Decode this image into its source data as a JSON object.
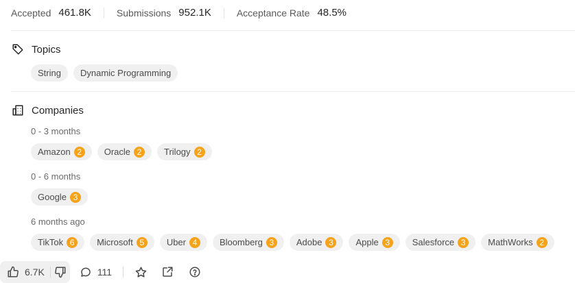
{
  "stats": [
    {
      "label": "Accepted",
      "value": "461.8K"
    },
    {
      "label": "Submissions",
      "value": "952.1K"
    },
    {
      "label": "Acceptance Rate",
      "value": "48.5%"
    }
  ],
  "topics": {
    "title": "Topics",
    "icon": "tag-icon",
    "tags": [
      "String",
      "Dynamic Programming"
    ]
  },
  "companies": {
    "title": "Companies",
    "icon": "building-icon",
    "groups": [
      {
        "period": "0 - 3 months",
        "items": [
          {
            "name": "Amazon",
            "count": "2"
          },
          {
            "name": "Oracle",
            "count": "2"
          },
          {
            "name": "Trilogy",
            "count": "2"
          }
        ]
      },
      {
        "period": "0 - 6 months",
        "items": [
          {
            "name": "Google",
            "count": "3"
          }
        ]
      },
      {
        "period": "6 months ago",
        "items": [
          {
            "name": "TikTok",
            "count": "6"
          },
          {
            "name": "Microsoft",
            "count": "5"
          },
          {
            "name": "Uber",
            "count": "4"
          },
          {
            "name": "Bloomberg",
            "count": "3"
          },
          {
            "name": "Adobe",
            "count": "3"
          },
          {
            "name": "Apple",
            "count": "3"
          },
          {
            "name": "Salesforce",
            "count": "3"
          },
          {
            "name": "MathWorks",
            "count": "2"
          }
        ]
      }
    ]
  },
  "toolbar": {
    "likes": "6.7K",
    "comments": "111",
    "icons": [
      "thumbs-up-icon",
      "thumbs-down-icon",
      "comment-icon",
      "star-icon",
      "share-icon",
      "help-icon"
    ]
  },
  "colors": {
    "badge": "#f6a31b",
    "chip_bg": "#f0f0f0"
  }
}
